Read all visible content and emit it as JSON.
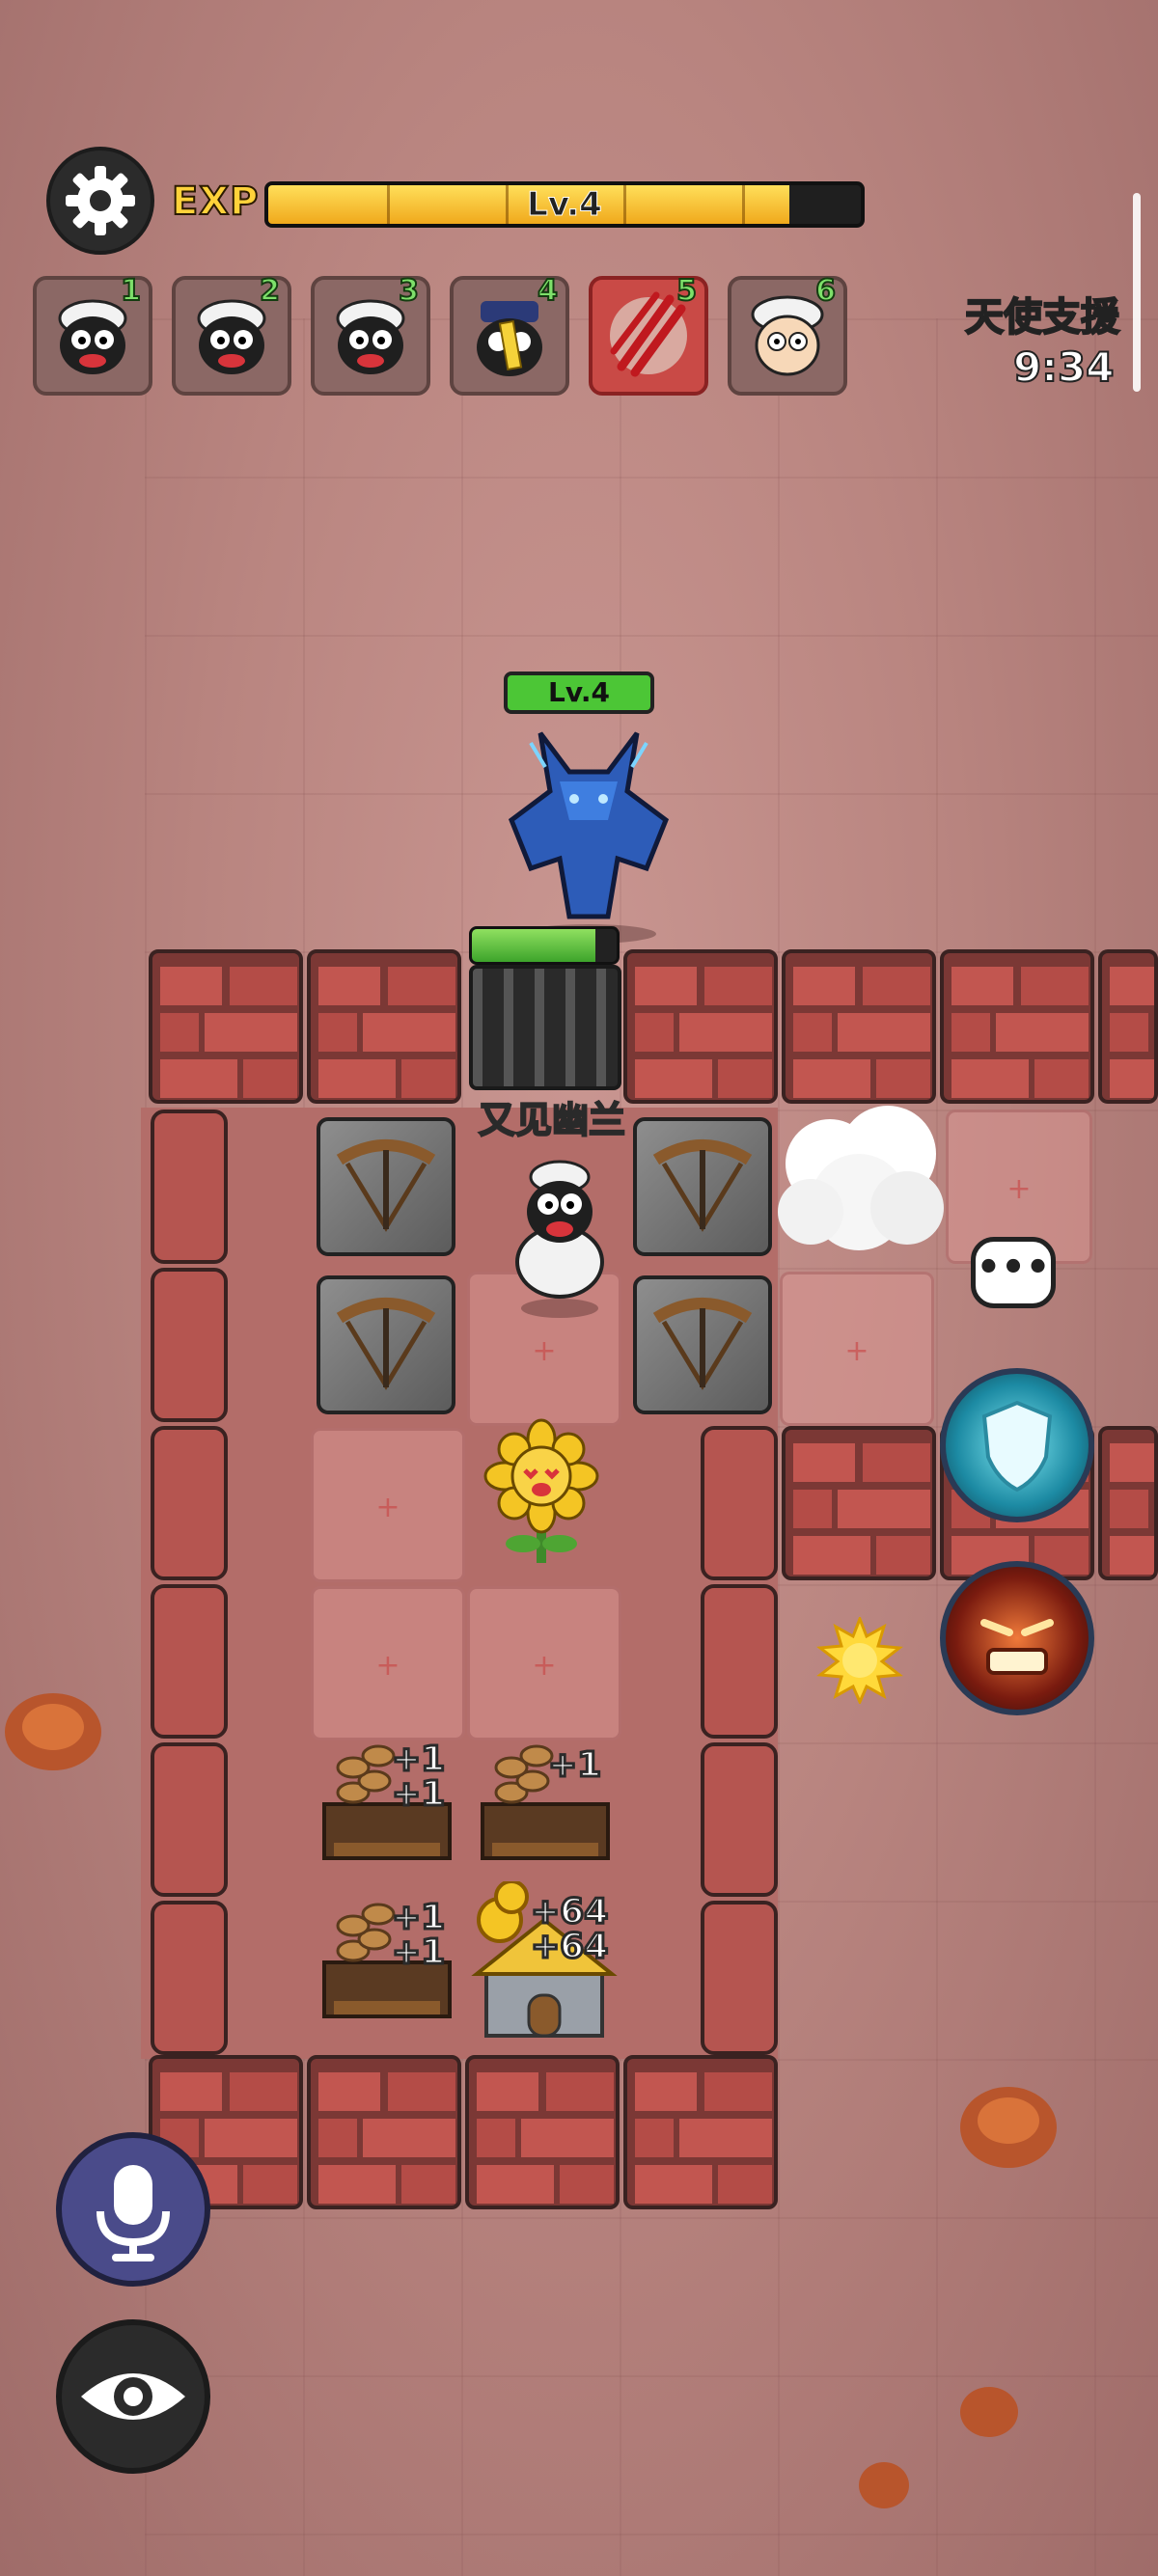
{
  "top_bar": {
    "exp_label": "EXP",
    "level_label": "Lv.4",
    "exp_progress": 0.88
  },
  "skill_slots": [
    {
      "number": "1",
      "icon": "sheep-face-icon",
      "active": false
    },
    {
      "number": "2",
      "icon": "sheep-face-icon",
      "active": false
    },
    {
      "number": "3",
      "icon": "sheep-face-icon",
      "active": false
    },
    {
      "number": "4",
      "icon": "jiangshi-sheep-icon",
      "active": false
    },
    {
      "number": "5",
      "icon": "claw-slash-icon",
      "active": true
    },
    {
      "number": "6",
      "icon": "white-sheep-icon",
      "active": false
    }
  ],
  "support": {
    "label": "天使支援",
    "timer": "9:34"
  },
  "boss": {
    "level_label": "Lv.4",
    "hp_fraction": 0.85
  },
  "player": {
    "name": "又见幽兰"
  },
  "resources": {
    "wood_bonus": "+1",
    "gold_bonus": "+64"
  },
  "colors": {
    "exp_fill": "#f0a91c",
    "hp_fill": "#4cc636",
    "active_slot": "#c94a46"
  },
  "icons": {
    "settings": "gear-icon",
    "microphone": "microphone-icon",
    "eye": "eye-icon",
    "shield": "shield-skill-icon",
    "rage": "rage-face-icon",
    "chat": "chat-bubble-icon",
    "sun": "sun-icon"
  }
}
